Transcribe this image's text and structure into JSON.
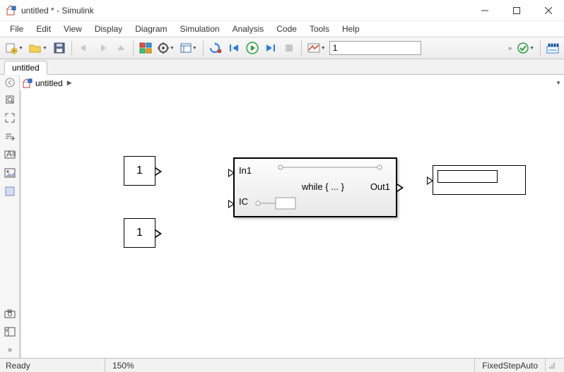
{
  "window": {
    "title": "untitled * - Simulink",
    "app_icon": "simulink-model-icon"
  },
  "menubar": [
    "File",
    "Edit",
    "View",
    "Display",
    "Diagram",
    "Simulation",
    "Analysis",
    "Code",
    "Tools",
    "Help"
  ],
  "toolbar": {
    "sim_time": "1"
  },
  "tabs": {
    "active": "untitled"
  },
  "breadcrumb": {
    "model": "untitled"
  },
  "blocks": {
    "const1": {
      "value": "1"
    },
    "const2": {
      "value": "1"
    },
    "while_sub": {
      "in1": "In1",
      "ic": "IC",
      "text": "while { ... }",
      "out1": "Out1"
    }
  },
  "status": {
    "ready": "Ready",
    "zoom": "150%",
    "solver": "FixedStepAuto"
  },
  "icons": {
    "min": "minimize-icon",
    "max": "maximize-icon",
    "close": "close-icon"
  }
}
